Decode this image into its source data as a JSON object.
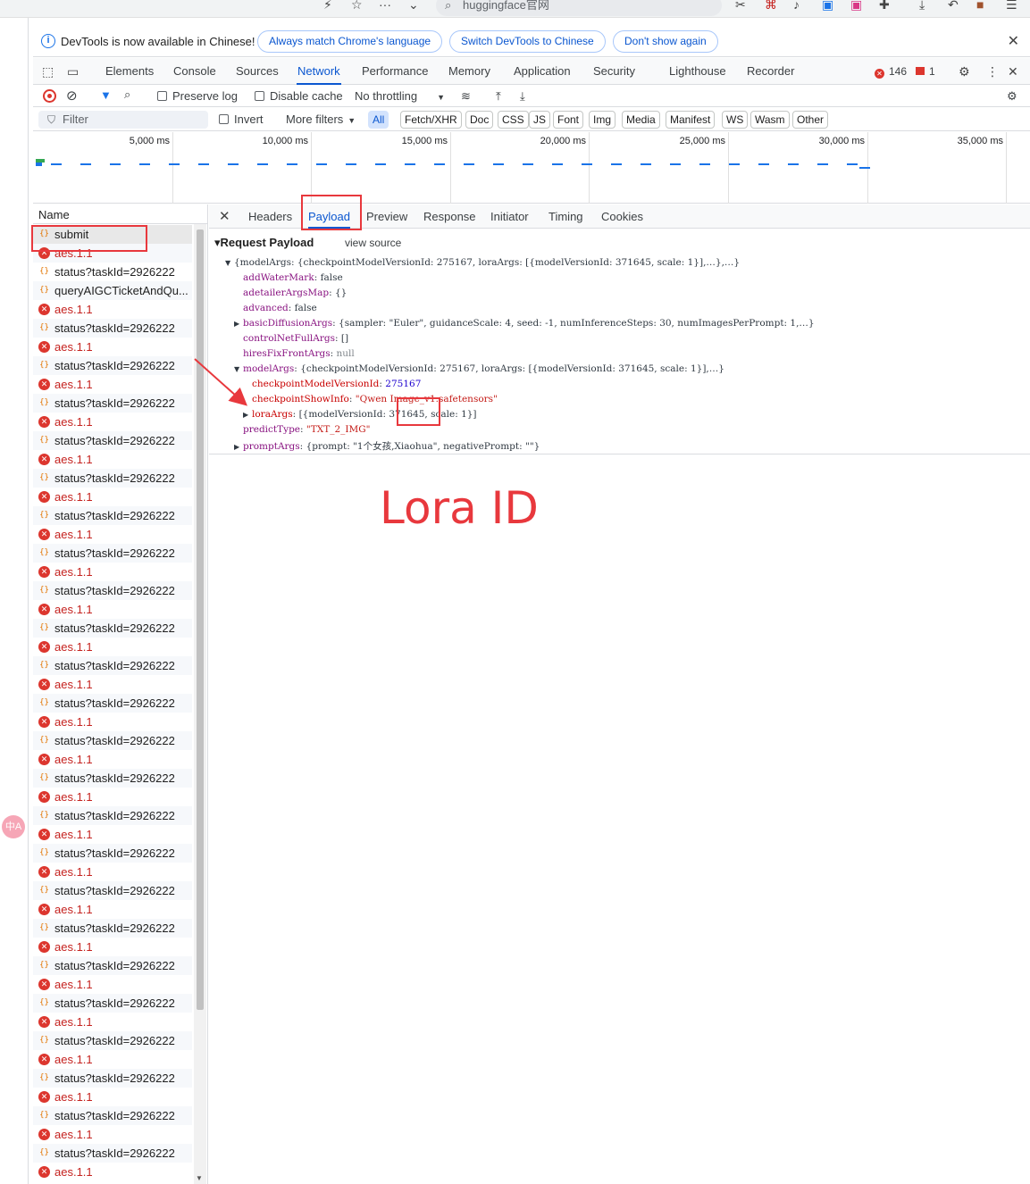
{
  "browser": {
    "address_text": "huggingface官网"
  },
  "infobar": {
    "message": "DevTools is now available in Chinese!",
    "btn_match": "Always match Chrome's language",
    "btn_switch": "Switch DevTools to Chinese",
    "btn_dont_show": "Don't show again"
  },
  "tabs": [
    "Elements",
    "Console",
    "Sources",
    "Network",
    "Performance",
    "Memory",
    "Application",
    "Security",
    "Lighthouse",
    "Recorder"
  ],
  "active_tab": "Network",
  "status": {
    "errors": "146",
    "warnings": "1"
  },
  "toolbar": {
    "preserve_log": "Preserve log",
    "disable_cache": "Disable cache",
    "throttling": "No throttling"
  },
  "filterbar": {
    "filter_placeholder": "Filter",
    "invert": "Invert",
    "more_filters": "More filters",
    "types": [
      "All",
      "Fetch/XHR",
      "Doc",
      "CSS",
      "JS",
      "Font",
      "Img",
      "Media",
      "Manifest",
      "WS",
      "Wasm",
      "Other"
    ]
  },
  "timeline": {
    "ticks": [
      "5,000 ms",
      "10,000 ms",
      "15,000 ms",
      "20,000 ms",
      "25,000 ms",
      "30,000 ms",
      "35,000 ms"
    ]
  },
  "list": {
    "header": "Name",
    "rows": [
      {
        "name": "submit",
        "type": "xhr"
      },
      {
        "name": "aes.1.1",
        "type": "err"
      },
      {
        "name": "status?taskId=2926222",
        "type": "xhr"
      },
      {
        "name": "queryAIGCTicketAndQu...",
        "type": "xhr"
      },
      {
        "name": "aes.1.1",
        "type": "err"
      },
      {
        "name": "status?taskId=2926222",
        "type": "xhr"
      },
      {
        "name": "aes.1.1",
        "type": "err"
      },
      {
        "name": "status?taskId=2926222",
        "type": "xhr"
      },
      {
        "name": "aes.1.1",
        "type": "err"
      },
      {
        "name": "status?taskId=2926222",
        "type": "xhr"
      },
      {
        "name": "aes.1.1",
        "type": "err"
      },
      {
        "name": "status?taskId=2926222",
        "type": "xhr"
      },
      {
        "name": "aes.1.1",
        "type": "err"
      },
      {
        "name": "status?taskId=2926222",
        "type": "xhr"
      },
      {
        "name": "aes.1.1",
        "type": "err"
      },
      {
        "name": "status?taskId=2926222",
        "type": "xhr"
      },
      {
        "name": "aes.1.1",
        "type": "err"
      },
      {
        "name": "status?taskId=2926222",
        "type": "xhr"
      },
      {
        "name": "aes.1.1",
        "type": "err"
      },
      {
        "name": "status?taskId=2926222",
        "type": "xhr"
      },
      {
        "name": "aes.1.1",
        "type": "err"
      },
      {
        "name": "status?taskId=2926222",
        "type": "xhr"
      },
      {
        "name": "aes.1.1",
        "type": "err"
      },
      {
        "name": "status?taskId=2926222",
        "type": "xhr"
      },
      {
        "name": "aes.1.1",
        "type": "err"
      },
      {
        "name": "status?taskId=2926222",
        "type": "xhr"
      },
      {
        "name": "aes.1.1",
        "type": "err"
      },
      {
        "name": "status?taskId=2926222",
        "type": "xhr"
      },
      {
        "name": "aes.1.1",
        "type": "err"
      },
      {
        "name": "status?taskId=2926222",
        "type": "xhr"
      },
      {
        "name": "aes.1.1",
        "type": "err"
      },
      {
        "name": "status?taskId=2926222",
        "type": "xhr"
      },
      {
        "name": "aes.1.1",
        "type": "err"
      },
      {
        "name": "status?taskId=2926222",
        "type": "xhr"
      },
      {
        "name": "aes.1.1",
        "type": "err"
      },
      {
        "name": "status?taskId=2926222",
        "type": "xhr"
      },
      {
        "name": "aes.1.1",
        "type": "err"
      },
      {
        "name": "status?taskId=2926222",
        "type": "xhr"
      },
      {
        "name": "aes.1.1",
        "type": "err"
      },
      {
        "name": "status?taskId=2926222",
        "type": "xhr"
      },
      {
        "name": "aes.1.1",
        "type": "err"
      },
      {
        "name": "status?taskId=2926222",
        "type": "xhr"
      },
      {
        "name": "aes.1.1",
        "type": "err"
      },
      {
        "name": "status?taskId=2926222",
        "type": "xhr"
      },
      {
        "name": "aes.1.1",
        "type": "err"
      },
      {
        "name": "status?taskId=2926222",
        "type": "xhr"
      },
      {
        "name": "aes.1.1",
        "type": "err"
      },
      {
        "name": "status?taskId=2926222",
        "type": "xhr"
      },
      {
        "name": "aes.1.1",
        "type": "err"
      },
      {
        "name": "status?taskId=2926222",
        "type": "xhr"
      },
      {
        "name": "aes.1.1",
        "type": "err"
      }
    ]
  },
  "detail": {
    "tabs": [
      "Headers",
      "Payload",
      "Preview",
      "Response",
      "Initiator",
      "Timing",
      "Cookies"
    ],
    "active_tab": "Payload",
    "section_title": "Request Payload",
    "view_source": "view source",
    "lines": [
      {
        "key": "",
        "value": "{modelArgs: {checkpointModelVersionId: 275167, loraArgs: [{modelVersionId: 371645, scale: 1}],…},…}",
        "vtype": "obj",
        "tri": "down",
        "indent": 0
      },
      {
        "key": "addWaterMark",
        "value": "false",
        "vtype": "plain",
        "tri": "",
        "indent": 1
      },
      {
        "key": "adetailerArgsMap",
        "value": "{}",
        "vtype": "plain",
        "tri": "",
        "indent": 1
      },
      {
        "key": "advanced",
        "value": "false",
        "vtype": "plain",
        "tri": "",
        "indent": 1
      },
      {
        "key": "basicDiffusionArgs",
        "value": "{sampler: \"Euler\", guidanceScale: 4, seed: -1, numInferenceSteps: 30, numImagesPerPrompt: 1,…}",
        "vtype": "obj",
        "tri": "right",
        "indent": 1
      },
      {
        "key": "controlNetFullArgs",
        "value": "[]",
        "vtype": "plain",
        "tri": "",
        "indent": 1
      },
      {
        "key": "hiresFixFrontArgs",
        "value": "null",
        "vtype": "null",
        "tri": "",
        "indent": 1
      },
      {
        "key": "modelArgs",
        "value": "{checkpointModelVersionId: 275167, loraArgs: [{modelVersionId: 371645, scale: 1}],…}",
        "vtype": "obj",
        "tri": "down",
        "indent": 1
      },
      {
        "key": "checkpointModelVersionId",
        "value": "275167",
        "vtype": "num",
        "tri": "",
        "indent": 2
      },
      {
        "key": "checkpointShowInfo",
        "value": "\"Qwen Image_v1.safetensors\"",
        "vtype": "str",
        "tri": "",
        "indent": 2
      },
      {
        "key": "loraArgs",
        "value": "[{modelVersionId: 371645, scale: 1}]",
        "vtype": "obj",
        "tri": "right",
        "indent": 2
      },
      {
        "key": "predictType",
        "value": "\"TXT_2_IMG\"",
        "vtype": "str",
        "tri": "",
        "indent": 1
      },
      {
        "key": "promptArgs",
        "value": "{prompt: \"1个女孩,Xiaohua\", negativePrompt: \"\"}",
        "vtype": "obj",
        "tri": "right",
        "indent": 1
      }
    ]
  },
  "annotation": {
    "label": "Lora ID"
  },
  "colors": {
    "accent": "#0b57d0",
    "error": "#dc362e",
    "annotation": "#e8383d"
  }
}
